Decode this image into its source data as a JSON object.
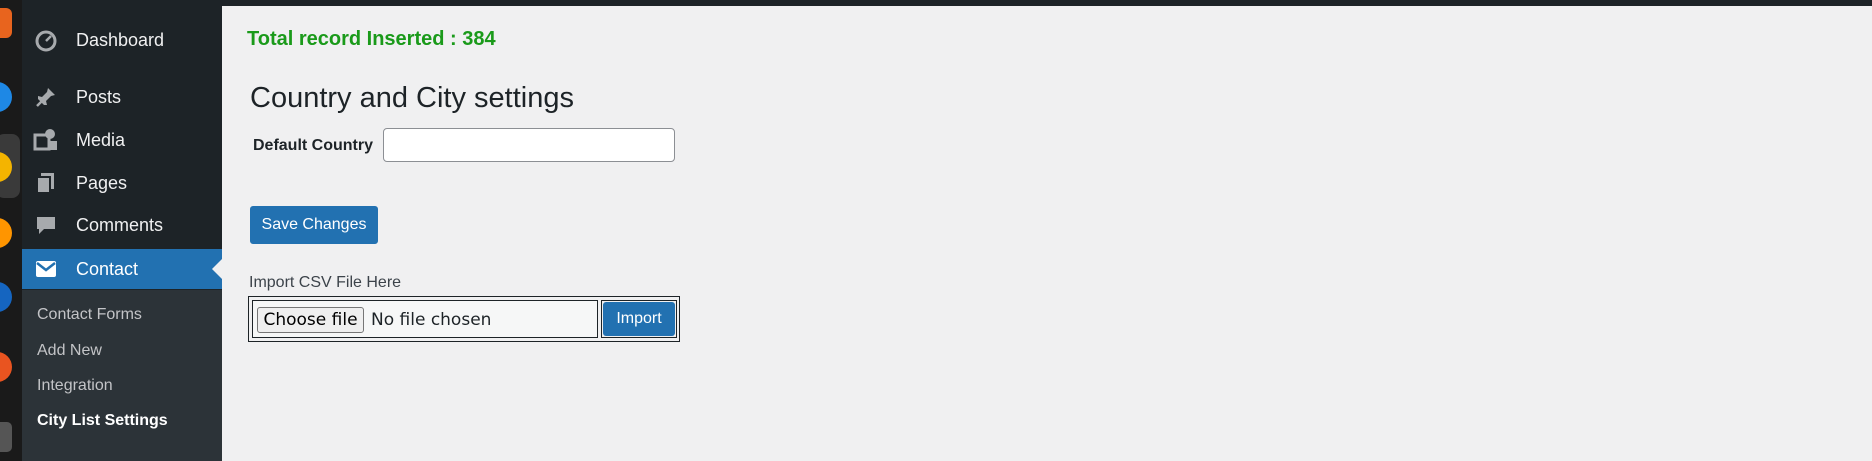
{
  "sidebar": {
    "items": [
      {
        "label": "Dashboard",
        "icon": "dashboard-icon"
      },
      {
        "label": "Posts",
        "icon": "pin-icon"
      },
      {
        "label": "Media",
        "icon": "media-icon"
      },
      {
        "label": "Pages",
        "icon": "pages-icon"
      },
      {
        "label": "Comments",
        "icon": "comment-icon"
      },
      {
        "label": "Contact",
        "icon": "envelope-icon",
        "active": true
      }
    ],
    "submenu": [
      {
        "label": "Contact Forms"
      },
      {
        "label": "Add New"
      },
      {
        "label": "Integration"
      },
      {
        "label": "City List Settings",
        "current": true
      }
    ]
  },
  "main": {
    "notice": "Total record Inserted : 384",
    "title": "Country and City settings",
    "default_country_label": "Default Country",
    "default_country_value": "",
    "save_label": "Save Changes",
    "import_label": "Import CSV File Here",
    "choose_file_label": "Choose file",
    "no_file_text": "No file chosen",
    "import_button": "Import"
  },
  "colors": {
    "sidebar_bg": "#1d2327",
    "accent": "#2271b1",
    "notice_green": "#1a9a1a",
    "content_bg": "#f0f0f1"
  }
}
